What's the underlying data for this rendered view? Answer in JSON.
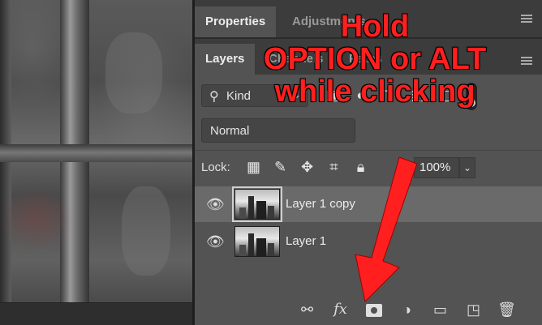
{
  "colors": {
    "annotation": "#ff1f1f",
    "panel_bg": "#535353",
    "selected_row": "#6a6a6a"
  },
  "properties_panel": {
    "tabs": [
      {
        "label": "Properties",
        "active": true
      },
      {
        "label": "Adjustments",
        "active": false
      }
    ]
  },
  "layers_panel": {
    "tabs": [
      {
        "label": "Layers",
        "active": true
      },
      {
        "label": "Channels",
        "active": false
      },
      {
        "label": "Paths",
        "active": false
      }
    ],
    "filter": {
      "kind_label": "Kind",
      "icons": [
        "image-filter-icon",
        "adjustment-filter-icon",
        "type-filter-icon",
        "shape-filter-icon",
        "smart-object-filter-icon"
      ]
    },
    "blend_mode": "Normal",
    "lock_label": "Lock:",
    "lock_icons": [
      "lock-transparent-icon",
      "lock-image-icon",
      "lock-position-icon",
      "lock-artboard-icon",
      "lock-all-icon"
    ],
    "opacity": "100%",
    "layers": [
      {
        "name": "Layer 1 copy",
        "selected": true,
        "visible": true
      },
      {
        "name": "Layer 1",
        "selected": false,
        "visible": true
      }
    ],
    "footer_icons": [
      "link-icon",
      "fx-icon",
      "add-mask-icon",
      "adjustment-layer-icon",
      "group-folder-icon",
      "new-layer-icon",
      "trash-icon"
    ]
  },
  "annotation": {
    "lines": [
      "Hold",
      "OPTION or ALT",
      "while clicking"
    ]
  }
}
